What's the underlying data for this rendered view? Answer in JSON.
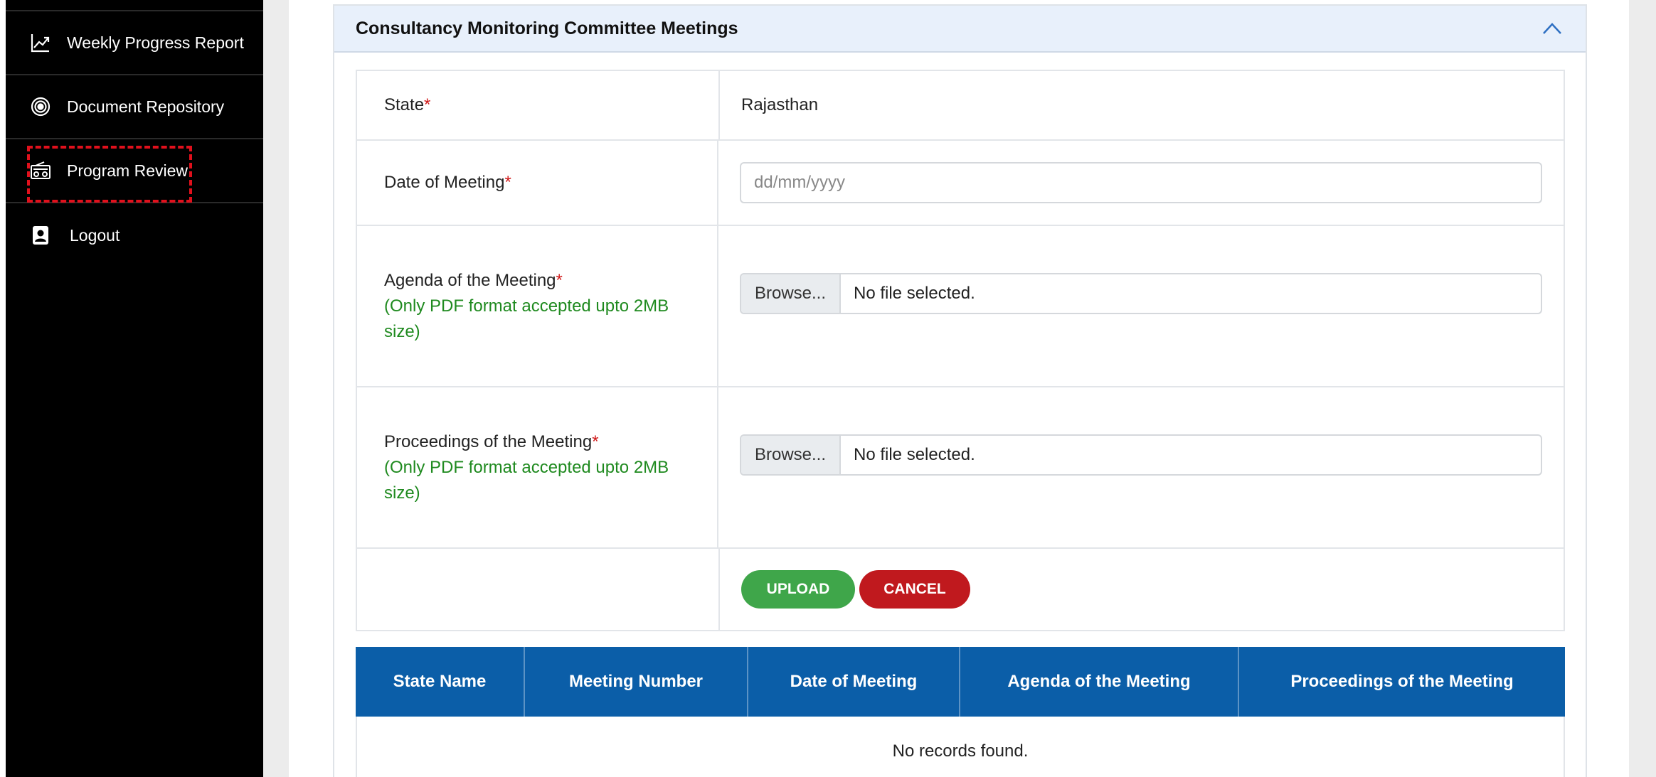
{
  "sidebar": {
    "items": [
      {
        "label": "Weekly Progress Report",
        "icon": "chart-trend-icon"
      },
      {
        "label": "Document Repository",
        "icon": "target-icon"
      },
      {
        "label": "Program Review",
        "icon": "radio-icon"
      },
      {
        "label": "Logout",
        "icon": "user-badge-icon"
      }
    ],
    "highlighted_item": "Program Review"
  },
  "card": {
    "title": "Consultancy Monitoring Committee Meetings",
    "collapse_icon": "chevron-up-icon"
  },
  "form": {
    "state_label": "State",
    "state_value": "Rajasthan",
    "date_label": "Date of Meeting",
    "date_placeholder": "dd/mm/yyyy",
    "agenda_label": "Agenda of the Meeting",
    "agenda_hint_line1": "(Only PDF format accepted upto 2MB",
    "agenda_hint_line2": "size)",
    "proceedings_label": "Proceedings of the Meeting",
    "proceedings_hint_line1": "(Only PDF format accepted upto 2MB",
    "proceedings_hint_line2": "size)",
    "required_mark": "*",
    "browse_label": "Browse...",
    "no_file_text": "No file selected.",
    "upload_label": "UPLOAD",
    "cancel_label": "CANCEL"
  },
  "records": {
    "columns": [
      "State Name",
      "Meeting Number",
      "Date of Meeting",
      "Agenda of the Meeting",
      "Proceedings of the Meeting"
    ],
    "empty_message": "No records found."
  },
  "colors": {
    "sidebar_bg": "#000000",
    "header_bg": "#e8f0fb",
    "table_head_bg": "#0b5ea8",
    "upload_btn": "#3fa64a",
    "cancel_btn": "#c0191e",
    "required": "#d01818",
    "hint": "#1f8a1f",
    "highlight": "#e0101c"
  }
}
